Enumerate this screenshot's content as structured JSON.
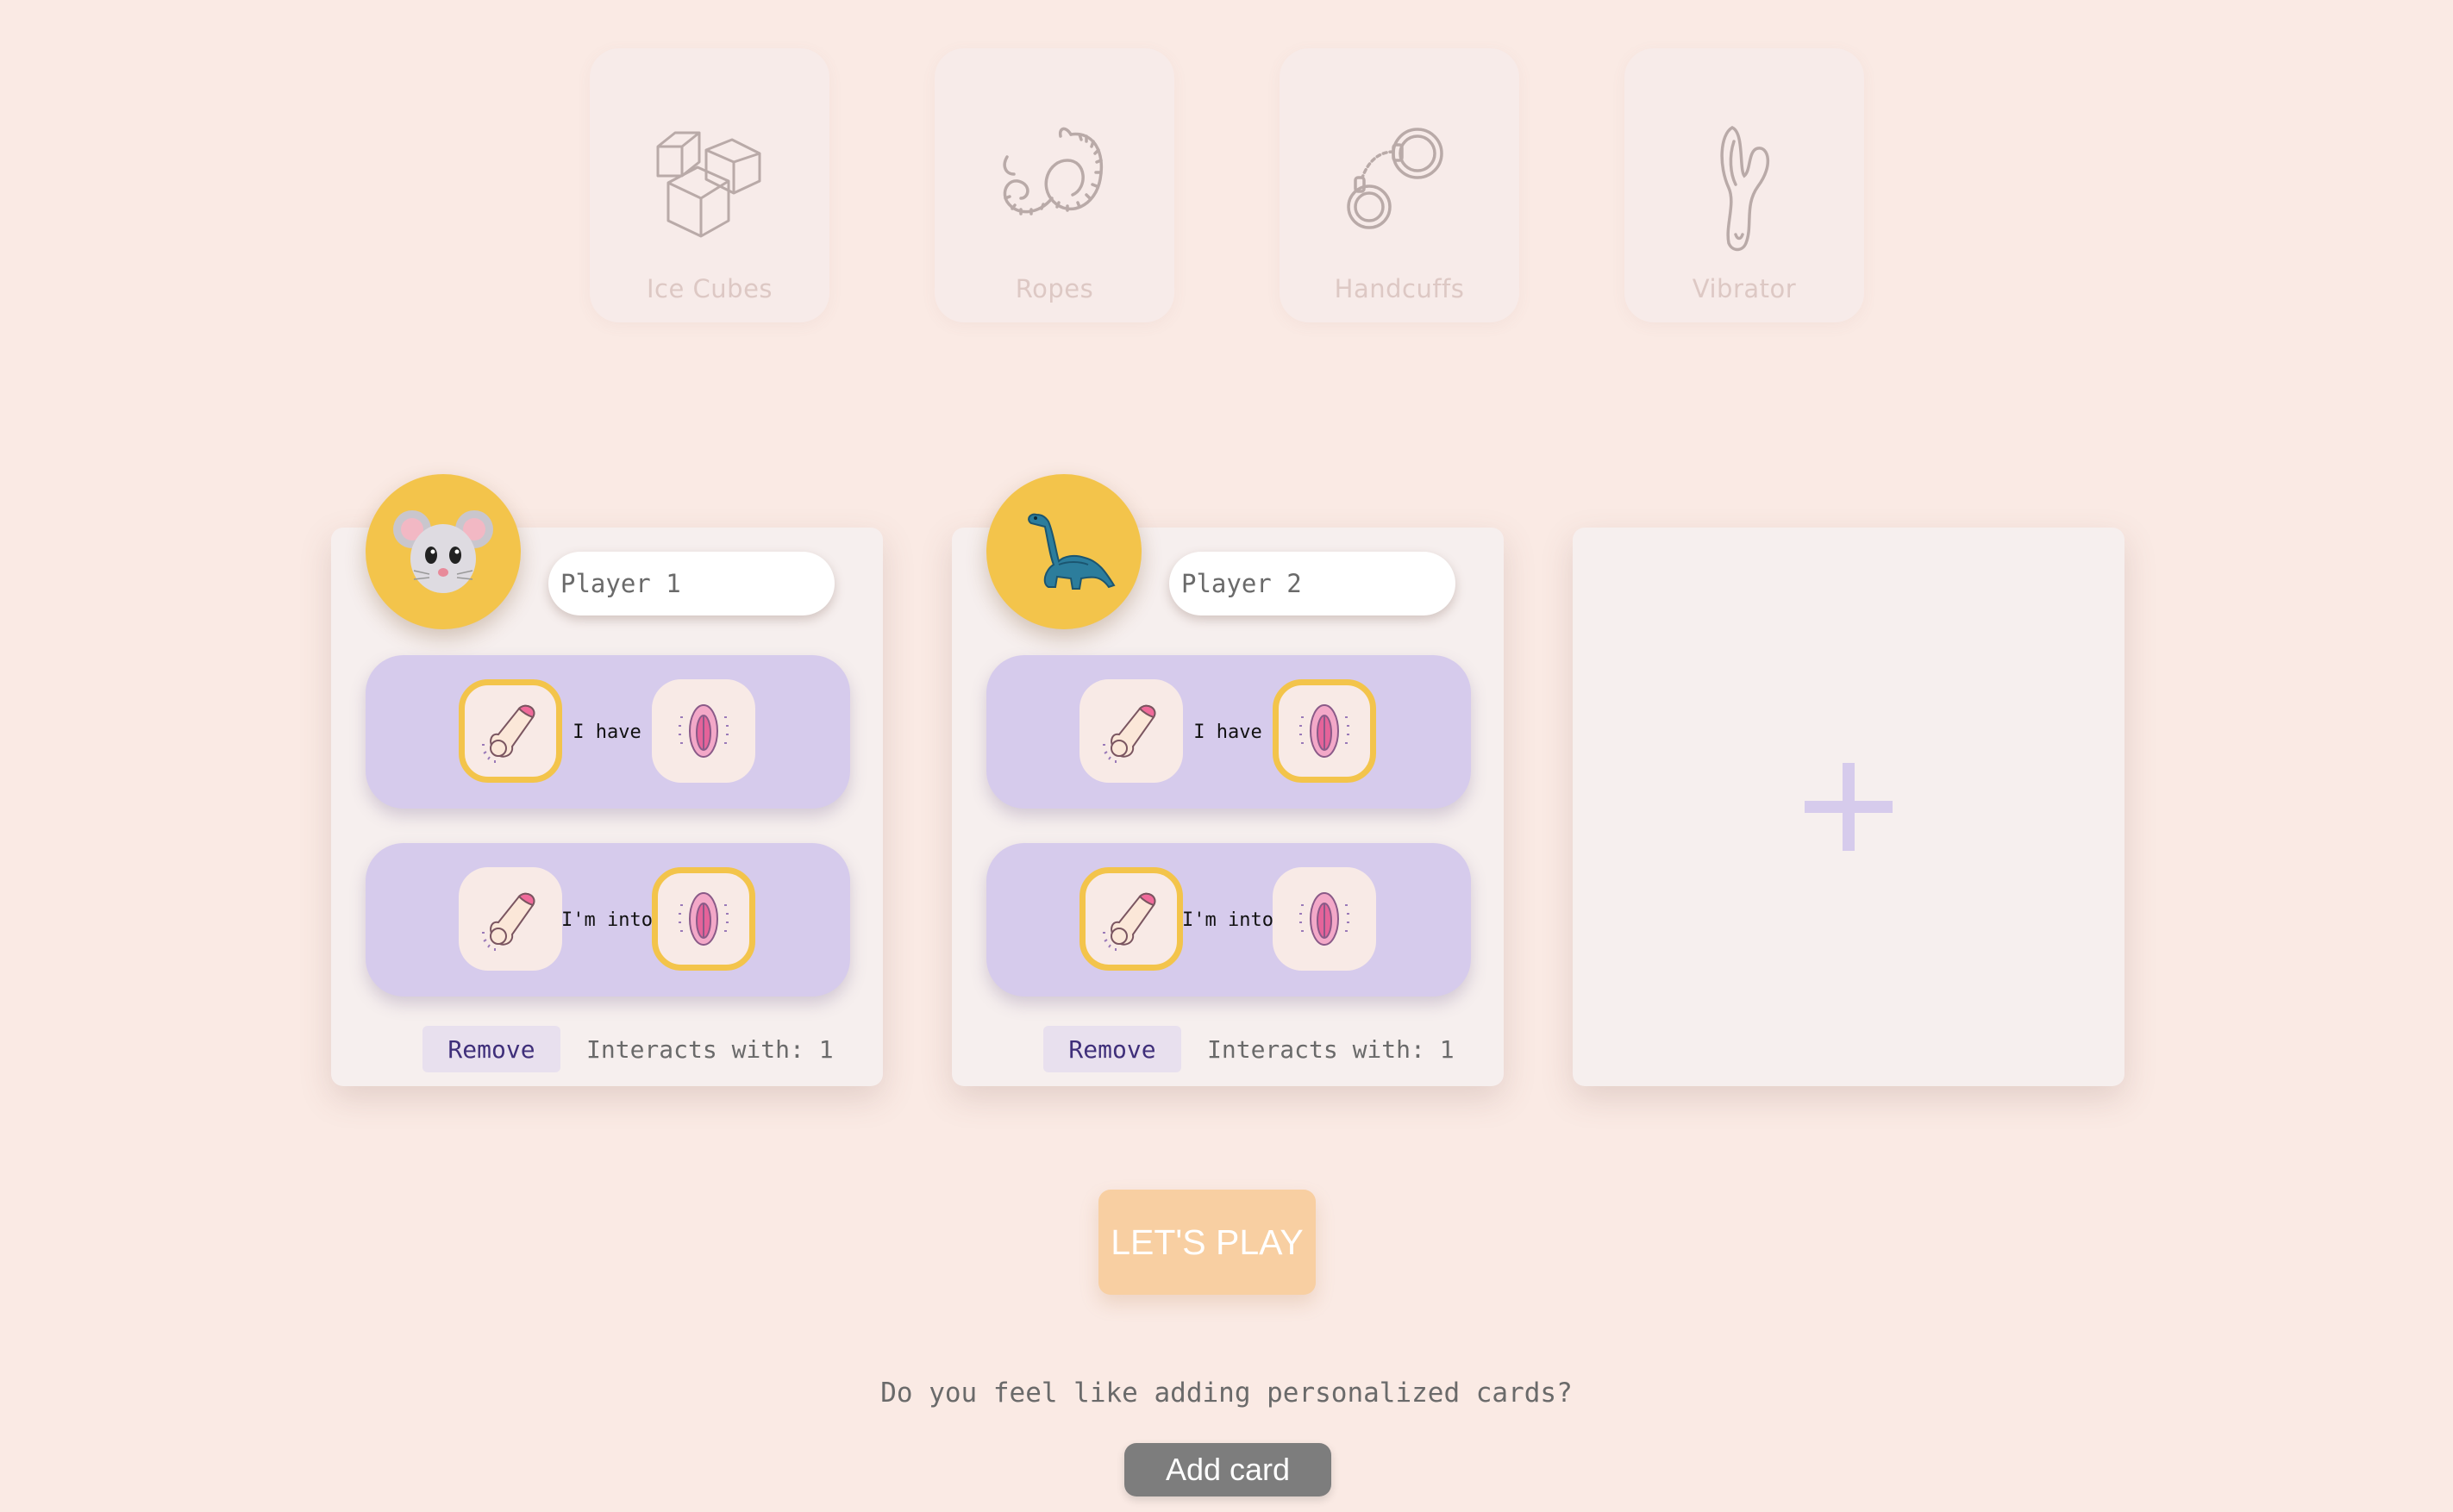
{
  "toys": [
    {
      "label": "Ice Cubes",
      "icon": "ice-cubes-icon"
    },
    {
      "label": "Ropes",
      "icon": "rope-icon"
    },
    {
      "label": "Handcuffs",
      "icon": "handcuffs-icon"
    },
    {
      "label": "Vibrator",
      "icon": "vibrator-icon"
    }
  ],
  "players": [
    {
      "avatar_emoji": "🐭",
      "name_value": "",
      "name_placeholder": "Player 1",
      "have_label": "I have",
      "into_label": "I'm into",
      "have_selected": "penis",
      "into_selected": "vulva",
      "remove_label": "Remove",
      "interacts_label": "Interacts with: 1"
    },
    {
      "avatar_emoji": "🦕",
      "name_value": "",
      "name_placeholder": "Player 2",
      "have_label": "I have",
      "into_label": "I'm into",
      "have_selected": "vulva",
      "into_selected": "penis",
      "remove_label": "Remove",
      "interacts_label": "Interacts with: 1"
    }
  ],
  "add_player_icon": "plus-icon",
  "play_button": "LET'S PLAY",
  "custom_cards_question": "Do you feel like adding personalized cards?",
  "add_card_button": "Add card",
  "colors": {
    "background": "#faeae4",
    "accent_yellow": "#f3c44b",
    "row_lavender": "#d6cbec",
    "play_button": "#f8cfa2",
    "add_card_button": "#7d7d7d"
  }
}
